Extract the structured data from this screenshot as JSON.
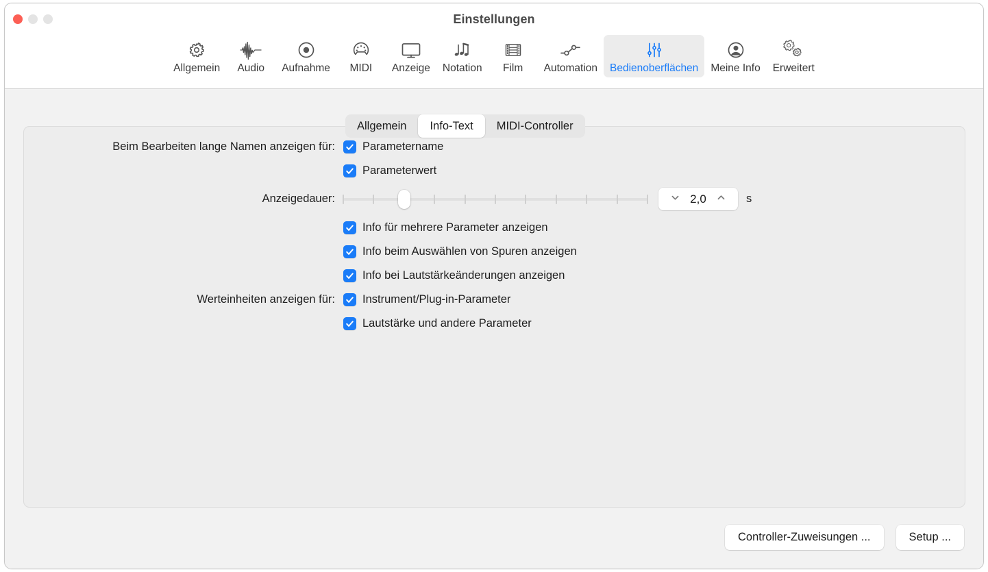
{
  "window": {
    "title": "Einstellungen",
    "traffic_lights": [
      {
        "name": "close",
        "color": "#fc5f55"
      },
      {
        "name": "minimize",
        "color": "#e4e4e4"
      },
      {
        "name": "zoom",
        "color": "#e4e4e4"
      }
    ]
  },
  "toolbar": {
    "accent_color": "#1a7cf8",
    "items": [
      {
        "label": "Allgemein",
        "icon": "gear-icon",
        "selected": false
      },
      {
        "label": "Audio",
        "icon": "waveform-icon",
        "selected": false
      },
      {
        "label": "Aufnahme",
        "icon": "record-circle-icon",
        "selected": false
      },
      {
        "label": "MIDI",
        "icon": "midi-connector-icon",
        "selected": false
      },
      {
        "label": "Anzeige",
        "icon": "display-monitor-icon",
        "selected": false
      },
      {
        "label": "Notation",
        "icon": "music-notes-icon",
        "selected": false
      },
      {
        "label": "Film",
        "icon": "film-strip-icon",
        "selected": false
      },
      {
        "label": "Automation",
        "icon": "automation-nodes-icon",
        "selected": false
      },
      {
        "label": "Bedienoberflächen",
        "icon": "sliders-icon",
        "selected": true
      },
      {
        "label": "Meine Info",
        "icon": "person-circle-icon",
        "selected": false
      },
      {
        "label": "Erweitert",
        "icon": "double-gear-icon",
        "selected": false
      }
    ]
  },
  "tabs": {
    "items": [
      {
        "label": "Allgemein",
        "active": false
      },
      {
        "label": "Info-Text",
        "active": true
      },
      {
        "label": "MIDI-Controller",
        "active": false
      }
    ]
  },
  "form": {
    "long_names_label": "Beim Bearbeiten lange Namen anzeigen für:",
    "long_names_options": [
      {
        "label": "Parametername",
        "checked": true
      },
      {
        "label": "Parameterwert",
        "checked": true
      }
    ],
    "duration_label": "Anzeigedauer:",
    "duration_slider": {
      "value": 2.0,
      "min": 0,
      "max": 10,
      "tick_count": 11,
      "thumb_tick_index": 2
    },
    "duration_value": "2,0",
    "duration_unit": "s",
    "stepper_icons": {
      "decrement": "chevron-down-icon",
      "increment": "chevron-up-icon"
    },
    "info_options": [
      {
        "label": "Info für mehrere Parameter anzeigen",
        "checked": true
      },
      {
        "label": "Info beim Auswählen von Spuren anzeigen",
        "checked": true
      },
      {
        "label": "Info bei Lautstärkeänderungen anzeigen",
        "checked": true
      }
    ],
    "units_label": "Werteinheiten anzeigen für:",
    "units_options": [
      {
        "label": "Instrument/Plug-in-Parameter",
        "checked": true
      },
      {
        "label": "Lautstärke und andere Parameter",
        "checked": true
      }
    ]
  },
  "footer": {
    "buttons": [
      {
        "label": "Controller-Zuweisungen ..."
      },
      {
        "label": "Setup ..."
      }
    ]
  }
}
